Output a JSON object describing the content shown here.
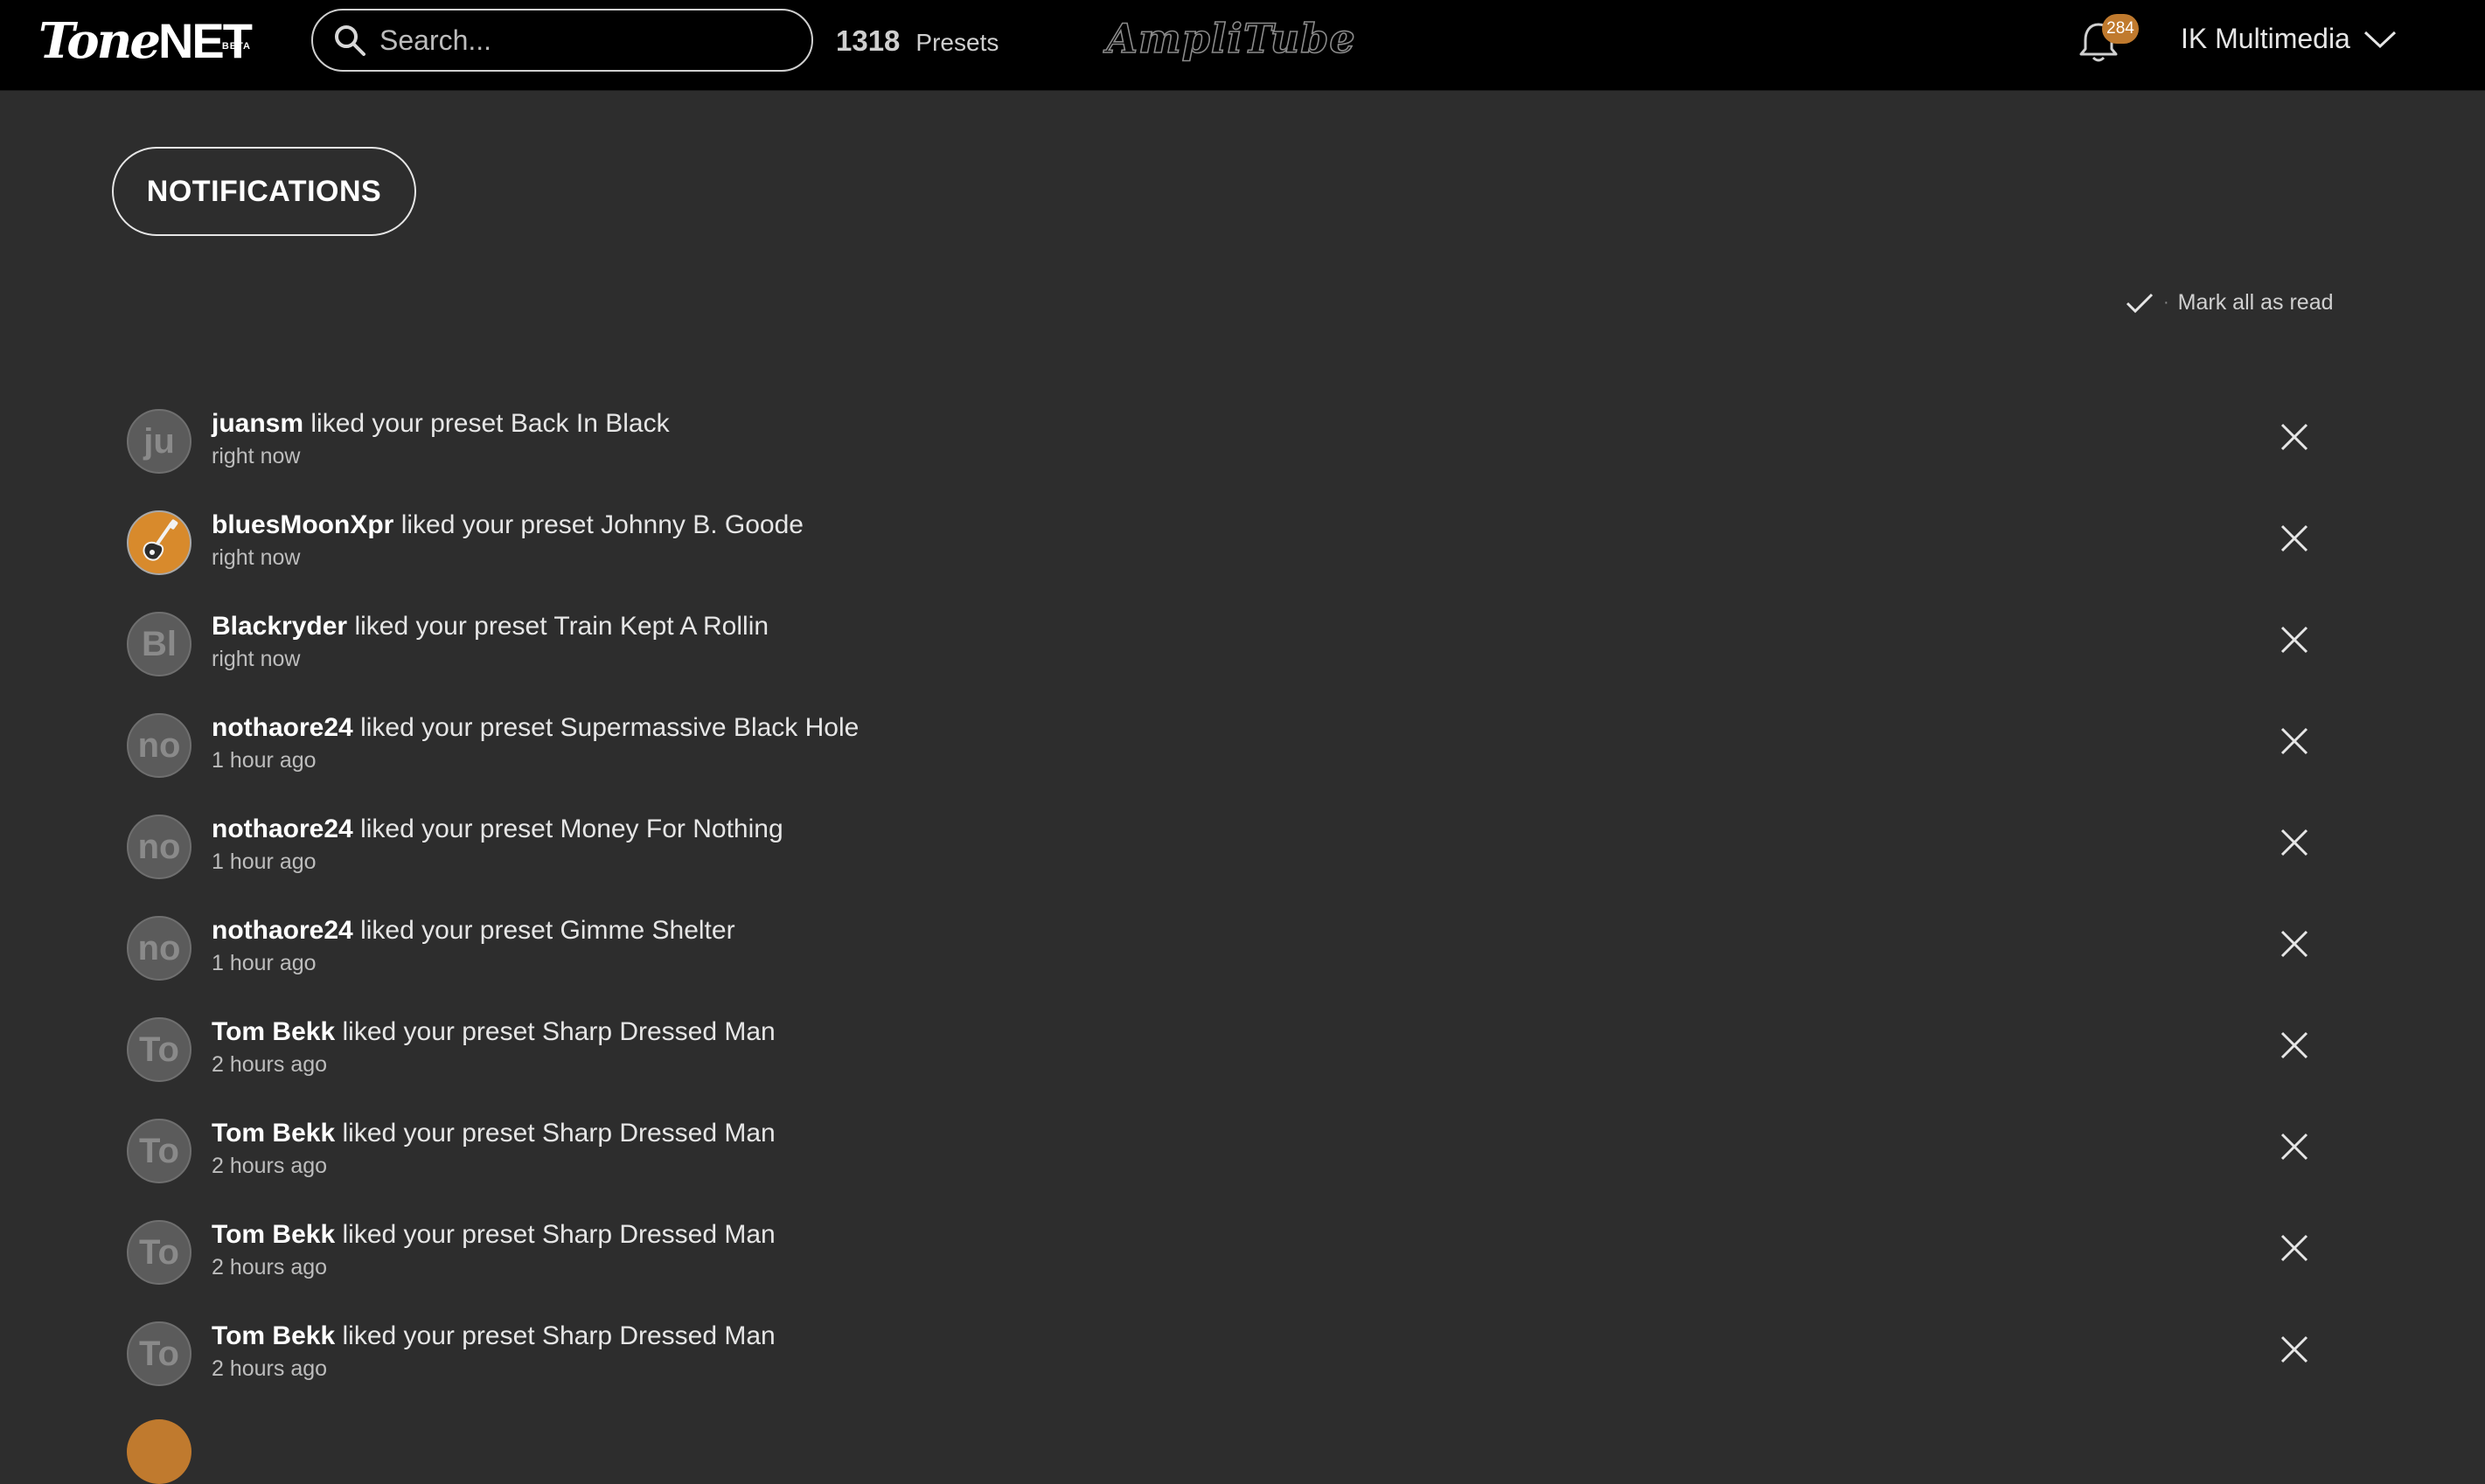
{
  "header": {
    "logo_tone": "Tone",
    "logo_net": "NET",
    "logo_beta": "BETA",
    "search_placeholder": "Search...",
    "presets_count": "1318",
    "presets_label": "Presets",
    "amplitube_logo": "AmpliTube",
    "notification_count": "284",
    "account_name": "IK Multimedia"
  },
  "page": {
    "notifications_label": "NOTIFICATIONS",
    "mark_all_label": "Mark all as read"
  },
  "notifications": [
    {
      "initials": "ju",
      "user": "juansm",
      "action": "liked your preset",
      "preset": "Back In Black",
      "time": "right now",
      "avatar_type": "initials"
    },
    {
      "initials": "",
      "user": "bluesMoonXpr",
      "action": "liked your preset",
      "preset": "Johnny B. Goode",
      "time": "right now",
      "avatar_type": "guitar"
    },
    {
      "initials": "Bl",
      "user": "Blackryder",
      "action": "liked your preset",
      "preset": "Train Kept A Rollin",
      "time": "right now",
      "avatar_type": "initials"
    },
    {
      "initials": "no",
      "user": "nothaore24",
      "action": "liked your preset",
      "preset": "Supermassive Black Hole",
      "time": "1 hour ago",
      "avatar_type": "initials"
    },
    {
      "initials": "no",
      "user": "nothaore24",
      "action": "liked your preset",
      "preset": "Money For Nothing",
      "time": "1 hour ago",
      "avatar_type": "initials"
    },
    {
      "initials": "no",
      "user": "nothaore24",
      "action": "liked your preset",
      "preset": "Gimme Shelter",
      "time": "1 hour ago",
      "avatar_type": "initials"
    },
    {
      "initials": "To",
      "user": "Tom Bekk",
      "action": "liked your preset",
      "preset": "Sharp Dressed Man",
      "time": "2 hours ago",
      "avatar_type": "initials"
    },
    {
      "initials": "To",
      "user": "Tom Bekk",
      "action": "liked your preset",
      "preset": "Sharp Dressed Man",
      "time": "2 hours ago",
      "avatar_type": "initials"
    },
    {
      "initials": "To",
      "user": "Tom Bekk",
      "action": "liked your preset",
      "preset": "Sharp Dressed Man",
      "time": "2 hours ago",
      "avatar_type": "initials"
    },
    {
      "initials": "To",
      "user": "Tom Bekk",
      "action": "liked your preset",
      "preset": "Sharp Dressed Man",
      "time": "2 hours ago",
      "avatar_type": "initials"
    }
  ],
  "icons": {
    "search": "search-icon",
    "bell": "bell-icon",
    "chevron": "chevron-down-icon",
    "check": "check-icon",
    "close": "close-icon"
  },
  "colors": {
    "background": "#2d2d2d",
    "topbar": "#000000",
    "badge": "#c07a2e",
    "avatar_guitar": "#d88a2c"
  }
}
